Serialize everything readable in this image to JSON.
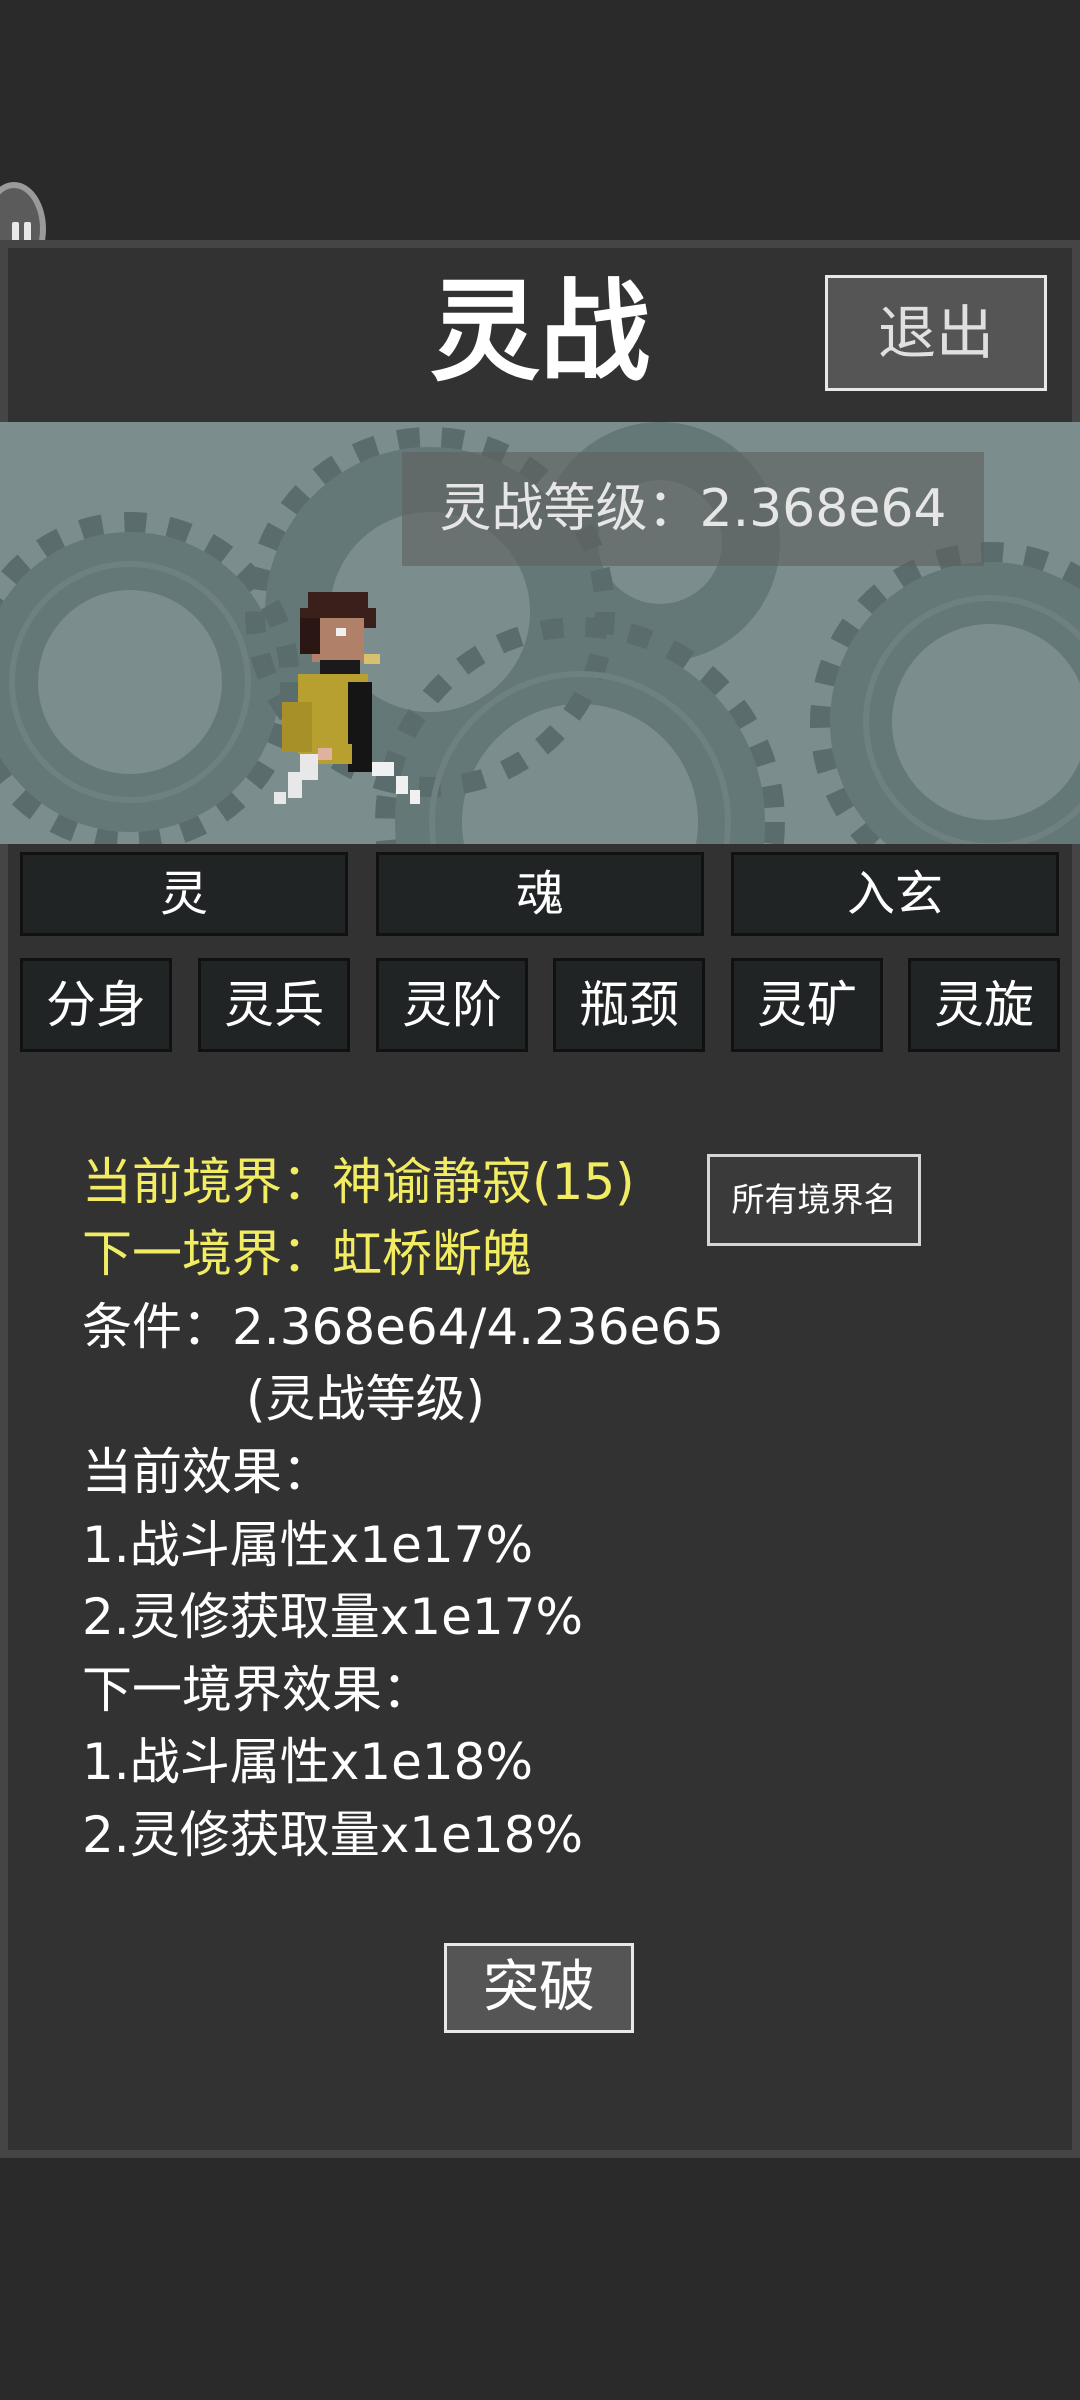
{
  "header": {
    "title": "灵战",
    "exit_label": "退出"
  },
  "scene": {
    "level_label": "灵战等级：2.368e64"
  },
  "tabs": [
    {
      "label": "灵",
      "active": true
    },
    {
      "label": "魂",
      "active": false
    },
    {
      "label": "入玄",
      "active": false
    }
  ],
  "subtabs": [
    {
      "label": "分身",
      "active": false
    },
    {
      "label": "灵兵",
      "active": false
    },
    {
      "label": "灵阶",
      "active": false
    },
    {
      "label": "瓶颈",
      "active": true
    },
    {
      "label": "灵矿",
      "active": false
    },
    {
      "label": "灵旋",
      "active": false
    }
  ],
  "realm": {
    "current": "当前境界：神谕静寂(15)",
    "next": "下一境界：虹桥断魄",
    "condition": "条件：2.368e64/4.236e65",
    "condition_unit": "(灵战等级)",
    "current_effects_title": "当前效果：",
    "current_effects": [
      "1.战斗属性x1e17%",
      "2.灵修获取量x1e17%"
    ],
    "next_effects_title": "下一境界效果：",
    "next_effects": [
      "1.战斗属性x1e18%",
      "2.灵修获取量x1e18%"
    ],
    "all_names_label": "所有境界名",
    "breakthrough_label": "突破"
  },
  "colors": {
    "highlight": "#f2ec62",
    "panel": "#323232",
    "scene_bg": "#7c8d8d"
  }
}
